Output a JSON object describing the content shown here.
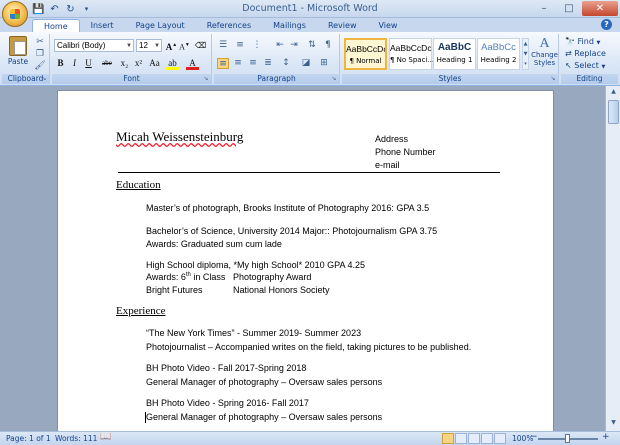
{
  "window": {
    "title": "Document1 - Microsoft Word",
    "controls": [
      "–",
      "□",
      "✕"
    ]
  },
  "quick_access": {
    "icons": [
      "save-icon",
      "undo-icon",
      "redo-icon",
      "customize-icon"
    ]
  },
  "tabs": [
    {
      "label": "Home",
      "active": true
    },
    {
      "label": "Insert"
    },
    {
      "label": "Page Layout"
    },
    {
      "label": "References"
    },
    {
      "label": "Mailings"
    },
    {
      "label": "Review"
    },
    {
      "label": "View"
    }
  ],
  "ribbon": {
    "clipboard": {
      "label": "Clipboard",
      "paste": "Paste"
    },
    "font": {
      "label": "Font",
      "family": "Calibri (Body)",
      "size": "12",
      "buttons": [
        "B",
        "I",
        "U",
        "abe",
        "x₂",
        "x²",
        "Aa",
        "A"
      ]
    },
    "paragraph": {
      "label": "Paragraph"
    },
    "styles": {
      "label": "Styles",
      "items": [
        {
          "sample": "AaBbCcDc",
          "name": "¶ Normal",
          "selected": true
        },
        {
          "sample": "AaBbCcDc",
          "name": "¶ No Spaci..."
        },
        {
          "sample": "AaBbC",
          "name": "Heading 1"
        },
        {
          "sample": "AaBbCc",
          "name": "Heading 2"
        }
      ],
      "change_styles": "Change Styles"
    },
    "editing": {
      "label": "Editing",
      "find": "Find",
      "replace": "Replace",
      "select": "Select"
    }
  },
  "document": {
    "name": "Micah Weissensteinburg",
    "contact": [
      "Address",
      "Phone Number",
      "e-mail"
    ],
    "education_heading": "Education",
    "edu1": "Master’s of photograph,  Brooks Institute of Photography  2016: GPA 3.5",
    "edu2": "Bachelor’s of Science, University 2014 Major:: Photojournalism  GPA 3.75",
    "edu2_awards_label": "Awards:",
    "edu2_awards": " Graduated sum cum lade",
    "edu3": "High School diploma, *My high School* 2010  GPA 4.25",
    "edu3_awards_label": "Awards:",
    "edu3_awards_a": " 6",
    "edu3_awards_sup": "th",
    "edu3_awards_b": " in Class",
    "edu3_award_right": "Photography Award",
    "edu3_line3_left": "Bright Futures",
    "edu3_line3_right": "National Honors Society",
    "experience_heading": "Experience",
    "exp1_title_a": "“The New York Times” -  Summer ",
    "exp1_title_b": "2019- Summer 2023",
    "exp1_desc": "Photojournalist – Accompanied writes on the field, taking pictures to be published.",
    "exp2_title": "BH Photo Video - Fall 2017-Spring 2018",
    "exp2_desc": "General Manager of photography – Oversaw sales persons",
    "exp3_title": "BH Photo Video - Spring 2016- Fall 2017",
    "exp3_desc": "General Manager of photography – Oversaw sales persons"
  },
  "status": {
    "page": "Page: 1 of 1",
    "words": "Words: 111",
    "zoom": "100%"
  }
}
